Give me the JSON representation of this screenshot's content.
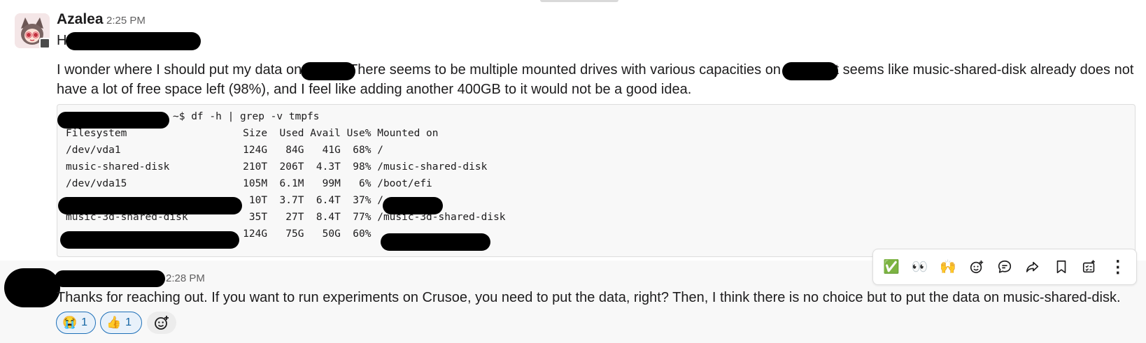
{
  "message1": {
    "author": "Azalea",
    "time": "2:25 PM",
    "greeting_visible": "H",
    "text_parts": [
      "I wonder where I should put my data on",
      "There seems to be multiple mounted drives with various capacities on",
      "It seems like music-shared-disk already does not",
      "have a lot of free space left (98%), and I feel like adding another 400GB to it would not be a good idea."
    ],
    "code": {
      "prompt": "~$ df -h | grep -v tmpfs",
      "header": "Filesystem                   Size  Used Avail Use% Mounted on",
      "rows": [
        "/dev/vda1                    124G   84G   41G  68% /",
        "music-shared-disk            210T  206T  4.3T  98% /music-shared-disk",
        "/dev/vda15                   105M  6.1M   99M   6% /boot/efi",
        "                              10T  3.7T  6.4T  37% /",
        "music-3d-shared-disk          35T   27T  8.4T  77% /music-3d-shared-disk",
        "                             124G   75G   50G  60%"
      ]
    }
  },
  "message2": {
    "time": "2:28 PM",
    "text": "Thanks for reaching out. If you want to run experiments on Crusoe, you need to put the data, right? Then, I think there is no choice but to put the data on music-shared-disk.",
    "reactions": [
      {
        "emoji": "😭",
        "count": "1"
      },
      {
        "emoji": "👍",
        "count": "1"
      }
    ]
  },
  "toolbar": {
    "items": [
      {
        "name": "check-mark-react-icon",
        "glyph": "✅"
      },
      {
        "name": "eyes-react-icon",
        "glyph": "👀"
      },
      {
        "name": "raised-hands-react-icon",
        "glyph": "🙌"
      },
      {
        "name": "add-reaction-icon",
        "glyph": ""
      },
      {
        "name": "reply-thread-icon",
        "glyph": ""
      },
      {
        "name": "forward-icon",
        "glyph": ""
      },
      {
        "name": "bookmark-icon",
        "glyph": ""
      },
      {
        "name": "list-add-icon",
        "glyph": ""
      },
      {
        "name": "more-actions-icon",
        "glyph": "⋮"
      }
    ]
  }
}
